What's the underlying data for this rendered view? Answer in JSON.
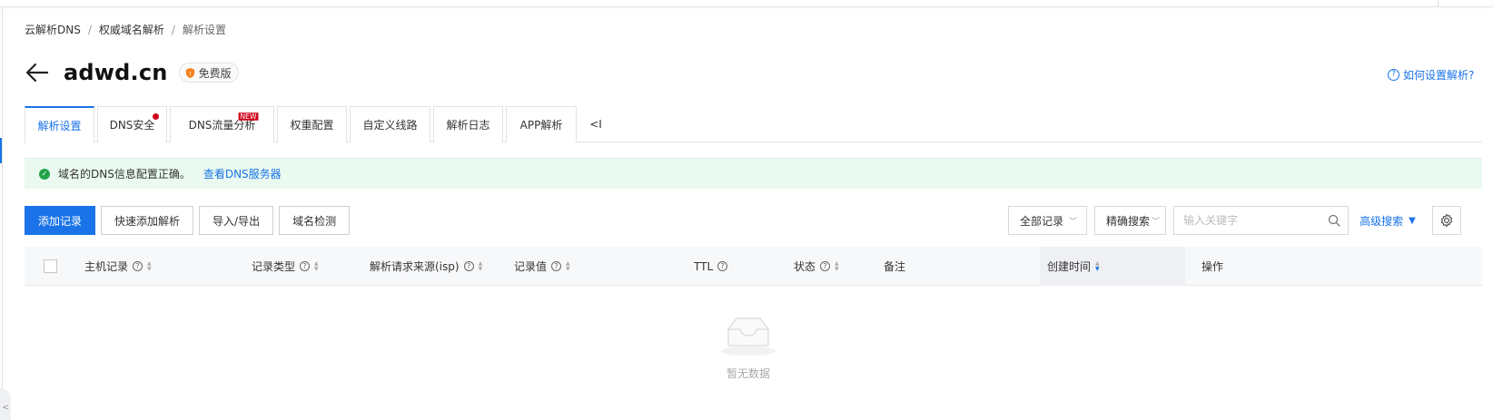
{
  "breadcrumb": {
    "items": [
      "云解析DNS",
      "权威域名解析",
      "解析设置"
    ],
    "separator": "/"
  },
  "header": {
    "title": "adwd.cn",
    "edition_badge": "免费版",
    "help_link": "如何设置解析?"
  },
  "tabs": [
    {
      "label": "解析设置",
      "active": true
    },
    {
      "label": "DNS安全",
      "dot": true
    },
    {
      "label": "DNS流量分析",
      "badge": "NEW"
    },
    {
      "label": "权重配置"
    },
    {
      "label": "自定义线路"
    },
    {
      "label": "解析日志"
    },
    {
      "label": "APP解析"
    }
  ],
  "tabs_more": "<I",
  "alert": {
    "message": "域名的DNS信息配置正确。",
    "link": "查看DNS服务器"
  },
  "toolbar": {
    "add_record": "添加记录",
    "quick_add": "快速添加解析",
    "import_export": "导入/导出",
    "domain_check": "域名检测"
  },
  "filters": {
    "record_filter": "全部记录",
    "search_mode": "精确搜索",
    "keyword_placeholder": "输入关键字",
    "advanced_search": "高级搜索"
  },
  "table": {
    "columns": {
      "host": "主机记录",
      "type": "记录类型",
      "isp": "解析请求来源(isp)",
      "value": "记录值",
      "ttl": "TTL",
      "status": "状态",
      "remark": "备注",
      "created": "创建时间",
      "actions": "操作"
    },
    "empty_text": "暂无数据"
  },
  "colors": {
    "primary": "#1a73e8",
    "success": "#22a34a",
    "alert_bg": "#eafaf0",
    "danger": "#d0021b"
  }
}
